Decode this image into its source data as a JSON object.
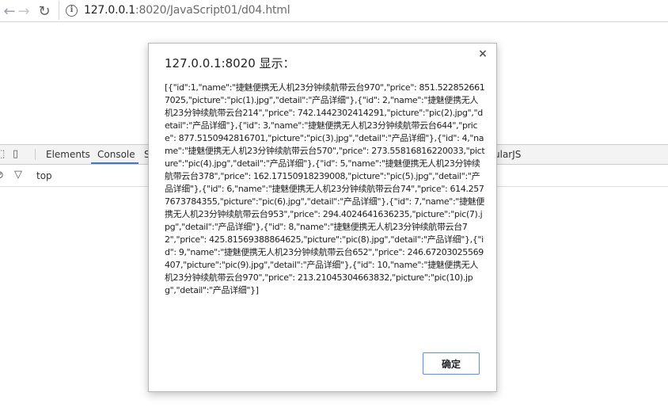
{
  "browser": {
    "url_host": "127.0.0.1",
    "url_path": ":8020/JavaScript01/d04.html",
    "back_glyph": "←",
    "forward_glyph": "→",
    "reload_glyph": "↻"
  },
  "devtools": {
    "tabs": {
      "elements": "Elements",
      "console": "Console",
      "sources_partial": "S",
      "angular_partial": "ularJS"
    },
    "context": "top"
  },
  "dialog": {
    "title": "127.0.0.1:8020 显示：",
    "message": "[{\"id\":1,\"name\":\"捷魅便携无人机23分钟续航带云台970\",\"price\": 851.5228526617025,\"picture\":\"pic(1).jpg\",\"detail\":\"产品详细\"},{\"id\": 2,\"name\":\"捷魅便携无人机23分钟续航带云台214\",\"price\": 742.1442302414291,\"picture\":\"pic(2).jpg\",\"detail\":\"产品详细\"},{\"id\": 3,\"name\":\"捷魅便携无人机23分钟续航带云台644\",\"price\": 877.5150942816701,\"picture\":\"pic(3).jpg\",\"detail\":\"产品详细\"},{\"id\": 4,\"name\":\"捷魅便携无人机23分钟续航带云台570\",\"price\": 273.55816816220033,\"picture\":\"pic(4).jpg\",\"detail\":\"产品详细\"},{\"id\": 5,\"name\":\"捷魅便携无人机23分钟续航带云台378\",\"price\": 162.17150918239008,\"picture\":\"pic(5).jpg\",\"detail\":\"产品详细\"},{\"id\": 6,\"name\":\"捷魅便携无人机23分钟续航带云台74\",\"price\": 614.2577673784355,\"picture\":\"pic(6).jpg\",\"detail\":\"产品详细\"},{\"id\": 7,\"name\":\"捷魅便携无人机23分钟续航带云台953\",\"price\": 294.4024641636235,\"picture\":\"pic(7).jpg\",\"detail\":\"产品详细\"},{\"id\": 8,\"name\":\"捷魅便携无人机23分钟续航带云台72\",\"price\": 425.81569388864625,\"picture\":\"pic(8).jpg\",\"detail\":\"产品详细\"},{\"id\": 9,\"name\":\"捷魅便携无人机23分钟续航带云台652\",\"price\": 246.67203025569407,\"picture\":\"pic(9).jpg\",\"detail\":\"产品详细\"},{\"id\": 10,\"name\":\"捷魅便携无人机23分钟续航带云台970\",\"price\": 213.21045304663832,\"picture\":\"pic(10).jpg\",\"detail\":\"产品详细\"}]",
    "ok_label": "确定",
    "close_glyph": "×"
  },
  "colors": {
    "accent": "#4d90fe",
    "console_tab_underline": "#3879d9"
  }
}
